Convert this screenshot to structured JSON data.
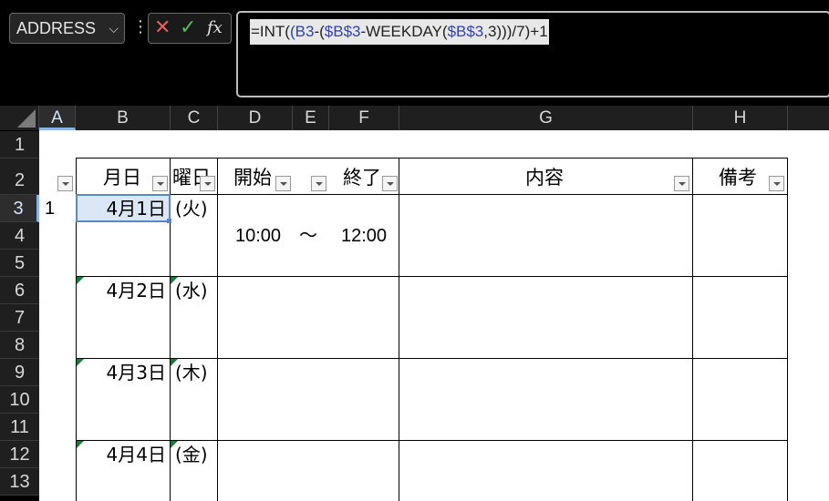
{
  "namebox": {
    "value": "ADDRESS",
    "chevron": "⌵"
  },
  "formula_bar": {
    "cancel_icon": "✕",
    "enter_icon": "✓",
    "fx_label": "fx",
    "formula_parts": [
      "=INT(",
      "(",
      "B3",
      "-(",
      "$B$3",
      "-WEEKDAY(",
      "$B$3",
      ",3)))/7)+1"
    ]
  },
  "columns": [
    "A",
    "B",
    "C",
    "D",
    "E",
    "F",
    "G",
    "H"
  ],
  "rows": [
    "1",
    "2",
    "3",
    "4",
    "5",
    "6",
    "7",
    "8",
    "9",
    "10",
    "11",
    "12",
    "13"
  ],
  "headers": {
    "date": "月日",
    "dow": "曜日",
    "start": "開始",
    "end": "終了",
    "content": "内容",
    "notes": "備考"
  },
  "cells": {
    "a3": "1",
    "time_start": "10:00",
    "tilde": "～",
    "time_end": "12:00"
  },
  "entries": [
    {
      "date": "4月1日",
      "dow": "(火)"
    },
    {
      "date": "4月2日",
      "dow": "(水)"
    },
    {
      "date": "4月3日",
      "dow": "(木)"
    },
    {
      "date": "4月4日",
      "dow": "(金)"
    }
  ],
  "colors": {
    "accent": "#8ab4e6",
    "selected_cell_fill": "#dbe7f7",
    "error_marker": "#1e7a3a"
  }
}
